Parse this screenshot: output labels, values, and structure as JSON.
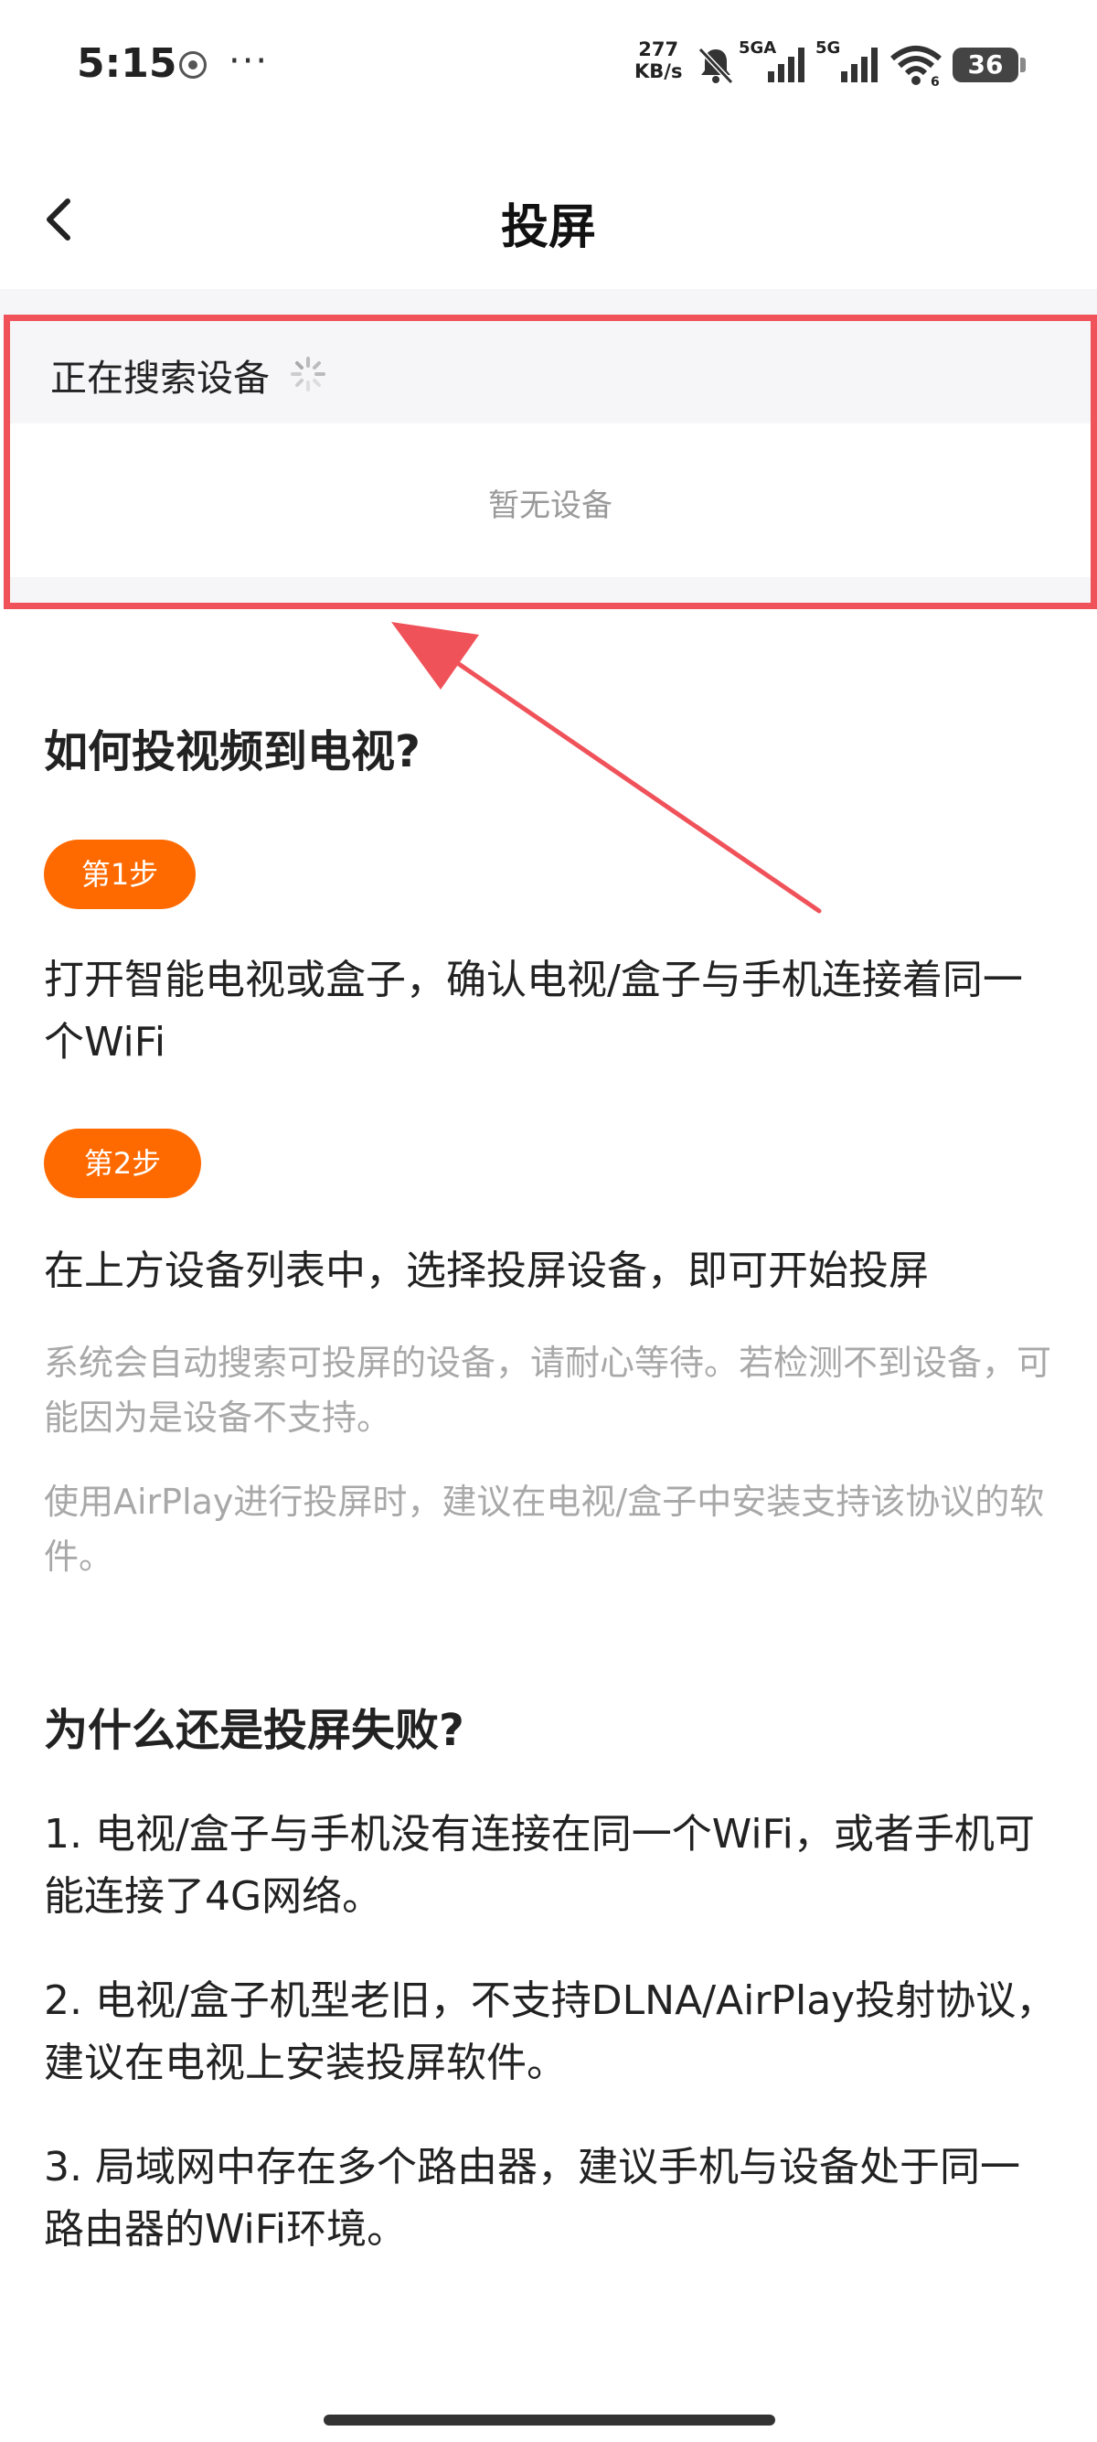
{
  "status_bar": {
    "time": "5:15",
    "more": "···",
    "speed_value": "277",
    "speed_unit": "KB/s",
    "net1_label": "5GA",
    "net2_label": "5G",
    "wifi_label": "6",
    "battery": "36"
  },
  "header": {
    "title": "投屏",
    "back_icon": "chevron-left-icon"
  },
  "devices": {
    "searching_label": "正在搜索设备",
    "empty_label": "暂无设备",
    "highlight_color": "#f0525a"
  },
  "guide": {
    "title": "如何投视频到电视?",
    "step1_badge": "第1步",
    "step1_text": "打开智能电视或盒子，确认电视/盒子与手机连接着同一个WiFi",
    "step2_badge": "第2步",
    "step2_text": "在上方设备列表中，选择投屏设备，即可开始投屏",
    "note1": "系统会自动搜索可投屏的设备，请耐心等待。若检测不到设备，可能因为是设备不支持。",
    "note2": "使用AirPlay进行投屏时，建议在电视/盒子中安装支持该协议的软件。",
    "accent_color": "#ff6a00"
  },
  "faq": {
    "title": "为什么还是投屏失败?",
    "items": [
      "1. 电视/盒子与手机没有连接在同一个WiFi，或者手机可能连接了4G网络。",
      "2. 电视/盒子机型老旧，不支持DLNA/AirPlay投射协议，建议在电视上安装投屏软件。",
      "3. 局域网中存在多个路由器，建议手机与设备处于同一路由器的WiFi环境。"
    ]
  }
}
